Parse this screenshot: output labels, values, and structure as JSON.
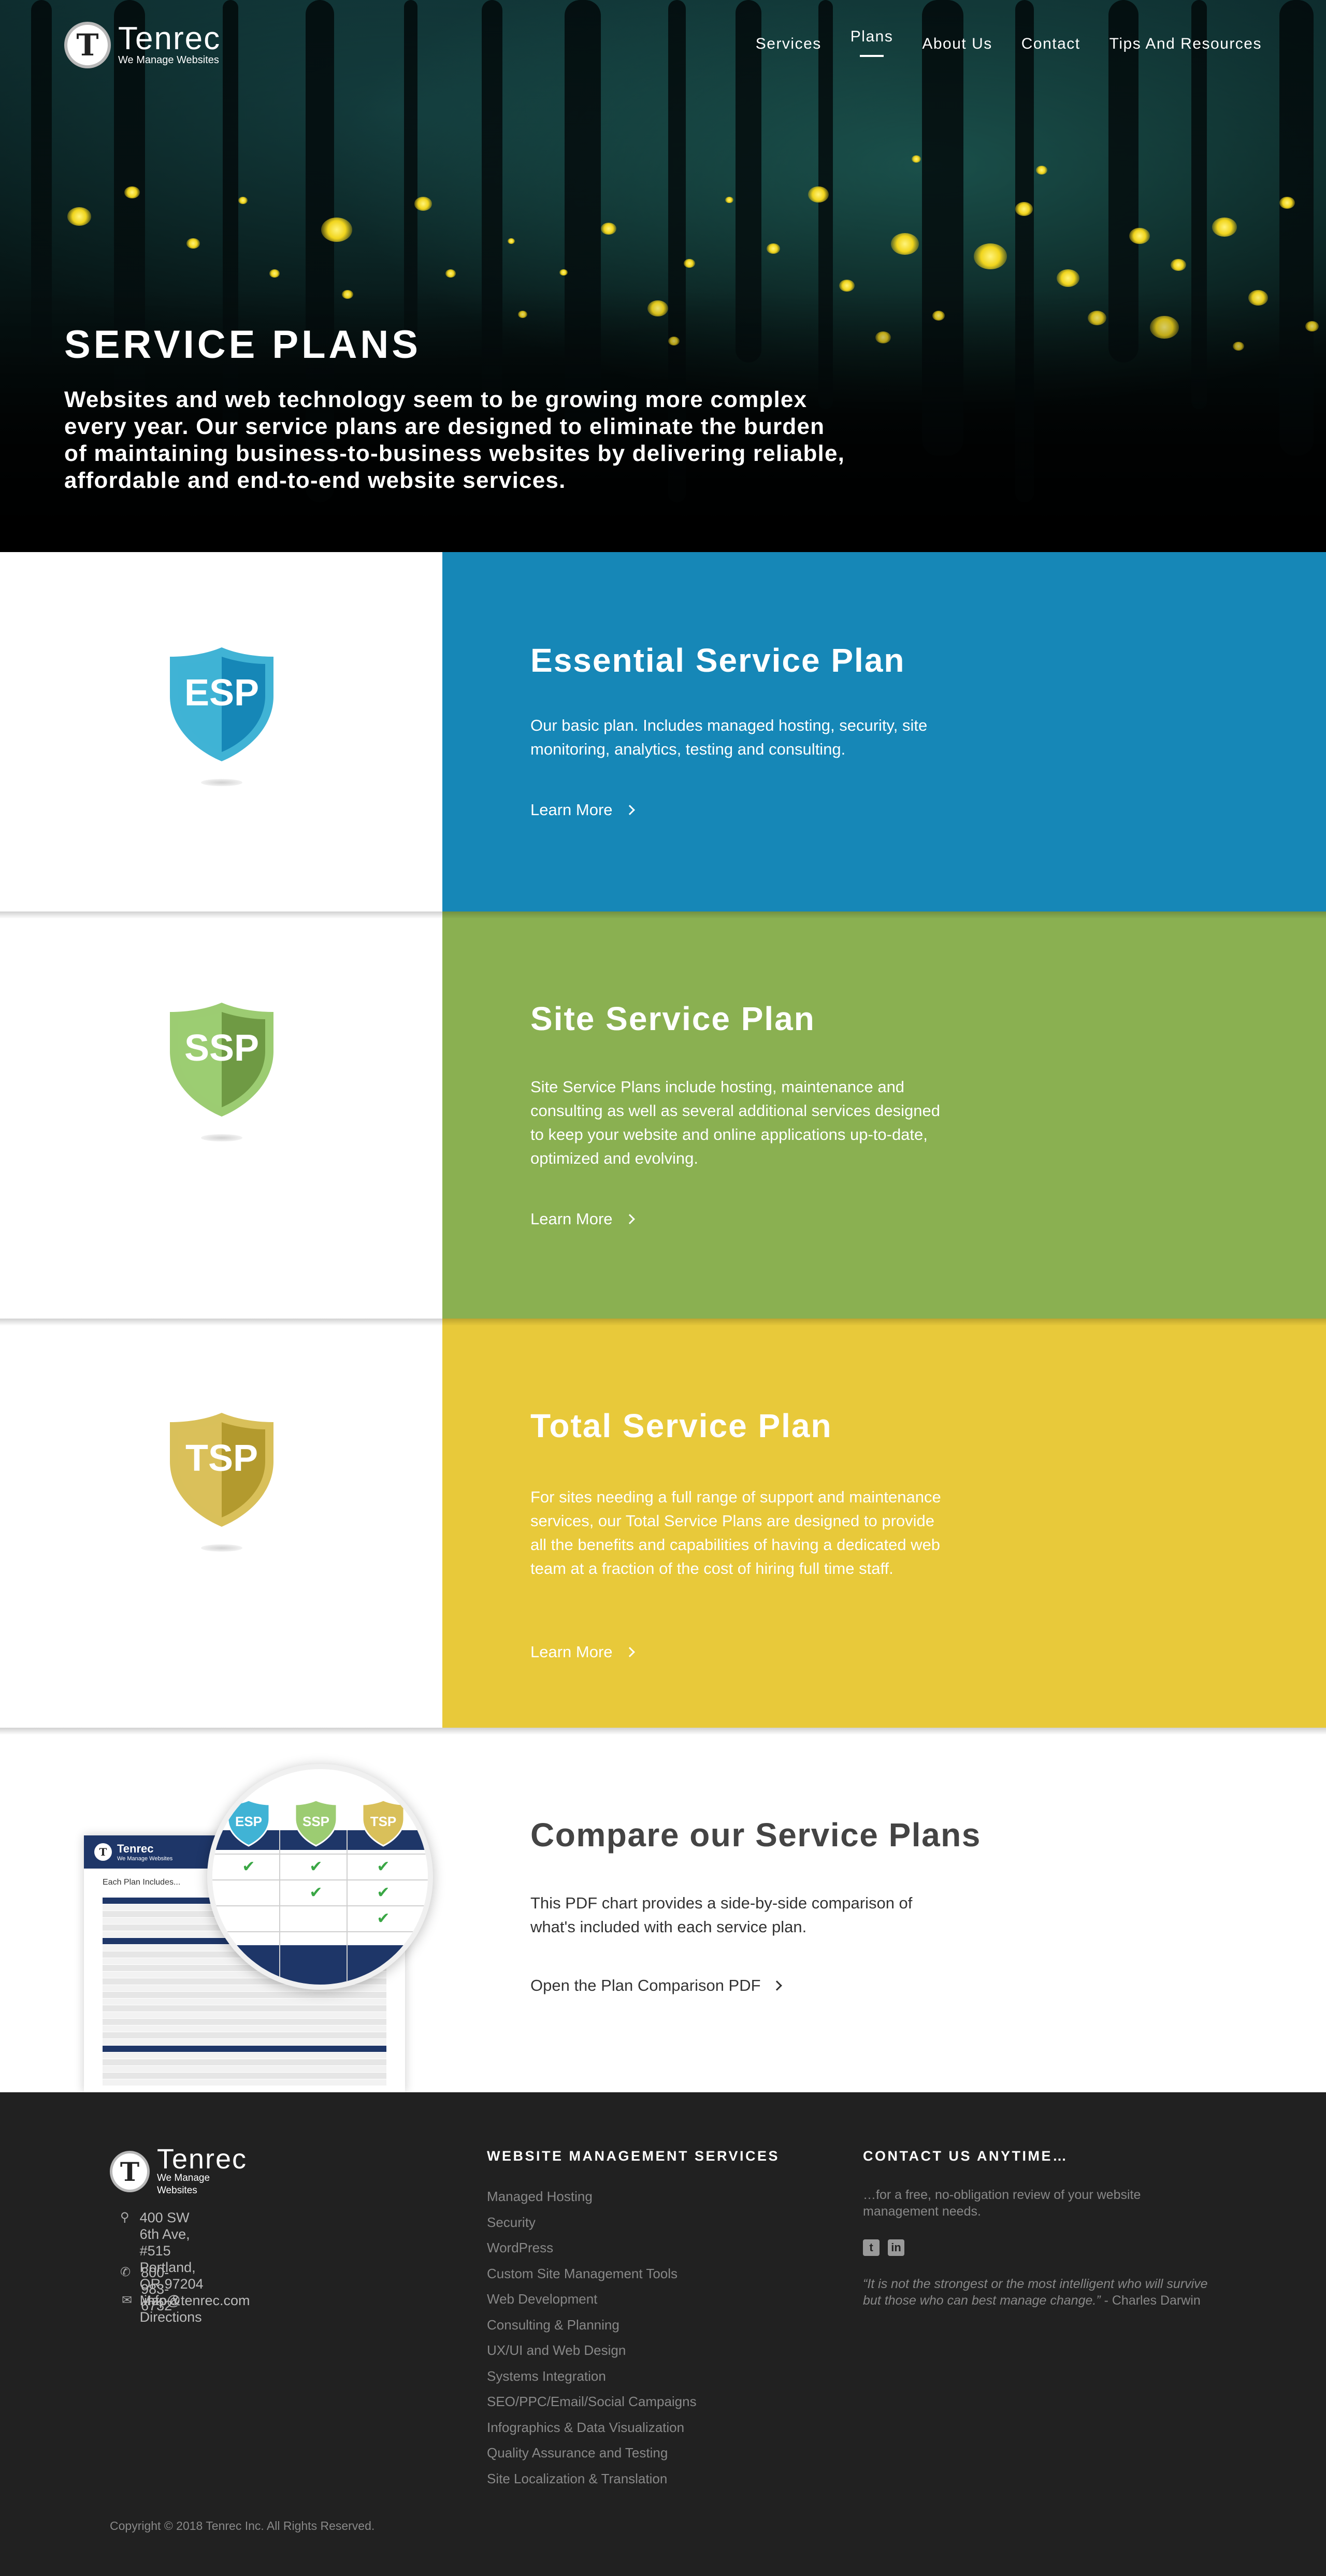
{
  "brand": {
    "name": "Tenrec",
    "tagline": "We Manage Websites",
    "mark": "T"
  },
  "nav": [
    {
      "label": "Services"
    },
    {
      "label": "Plans",
      "active": true
    },
    {
      "label": "About Us"
    },
    {
      "label": "Contact"
    },
    {
      "label": "Tips And Resources"
    }
  ],
  "hero": {
    "title": "SERVICE PLANS",
    "description": "Websites and web technology seem to be growing more complex every year. Our service plans are designed to eliminate the burden of maintaining business-to-business websites by delivering reliable, affordable and end-to-end website services."
  },
  "plans": [
    {
      "badge": "ESP",
      "title": "Essential Service Plan",
      "description": "Our basic plan. Includes managed hosting, security, site monitoring, analytics, testing and consulting.",
      "link": "Learn More",
      "color": "#1687b7",
      "shield_light": "#40b3d5",
      "shield_dark": "#1687b7"
    },
    {
      "badge": "SSP",
      "title": "Site Service Plan",
      "description": "Site Service Plans include hosting, maintenance and consulting as well as several additional services designed to keep your website and online applications up-to-date, optimized and evolving.",
      "link": "Learn More",
      "color": "#8ab051",
      "shield_light": "#9ccc72",
      "shield_dark": "#6f9a44"
    },
    {
      "badge": "TSP",
      "title": "Total Service Plan",
      "description": "For sites needing a full range of support and maintenance services, our Total Service Plans are designed to provide all the benefits and capabilities of having a dedicated web team at a fraction of the cost of hiring full time staff.",
      "link": "Learn More",
      "color": "#e8c93a",
      "shield_light": "#d9c05a",
      "shield_dark": "#b39a2e"
    }
  ],
  "compare": {
    "title": "Compare our Service Plans",
    "description": "This PDF chart provides a side-by-side comparison of what's included with each service plan.",
    "link": "Open the Plan Comparison PDF",
    "pdf_heading": "Each Plan Includes...",
    "pdf_brand": "Tenrec",
    "pdf_tagline": "We Manage Websites",
    "badges": [
      "ESP",
      "SSP",
      "TSP"
    ],
    "checkmark": "✔"
  },
  "footer": {
    "address_line1": "400 SW 6th Ave, #515",
    "address_line2": "Portland, OR 97204",
    "directions": "Map & Directions",
    "phone": "800-983-6732",
    "email": "info@tenrec.com",
    "services_heading": "WEBSITE MANAGEMENT SERVICES",
    "services": [
      "Managed Hosting",
      "Security",
      "WordPress",
      "Custom Site Management Tools",
      "Web Development",
      "Consulting & Planning",
      "UX/UI and Web Design",
      "Systems Integration",
      "SEO/PPC/Email/Social Campaigns",
      "Infographics & Data Visualization",
      "Quality Assurance and Testing",
      "Site Localization & Translation"
    ],
    "contact_heading": "CONTACT US ANYTIME…",
    "contact_text": "…for a free, no-obligation review of your website management needs.",
    "quote": "“It is not the strongest or the most intelligent who will survive but those who can best manage change.”",
    "quote_author": " - Charles Darwin",
    "copyright": "Copyright © 2018 Tenrec Inc. All Rights Reserved."
  },
  "icons": {
    "address": "map-pin-icon",
    "phone": "phone-icon",
    "email": "envelope-icon",
    "twitter": "twitter-icon",
    "linkedin": "linkedin-icon"
  }
}
